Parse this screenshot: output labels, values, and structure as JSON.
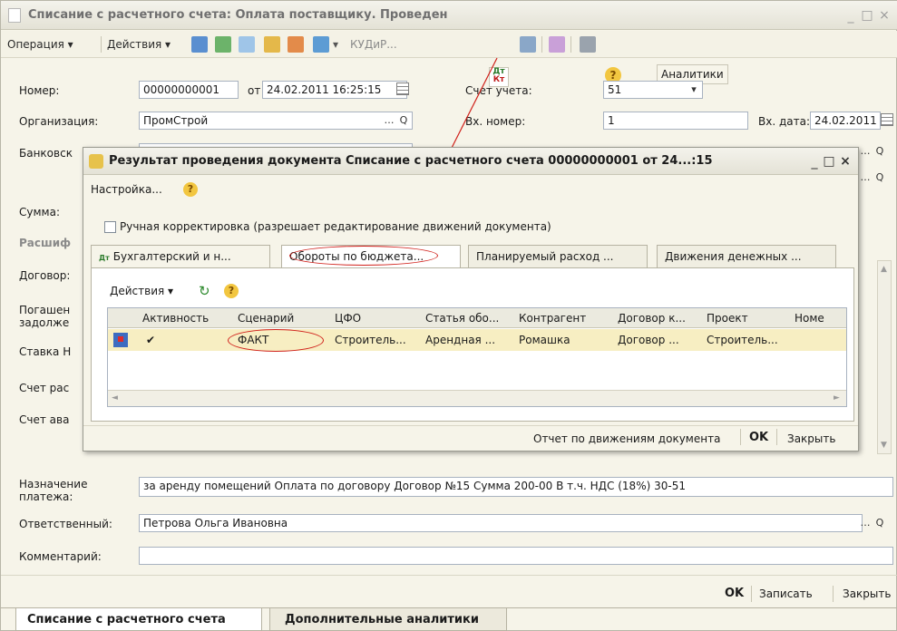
{
  "window": {
    "title": "Списание с расчетного счета: Оплата поставщику. Проведен",
    "min": "_",
    "max": "□",
    "close": "×"
  },
  "toolbar": {
    "operation": "Операция ▾",
    "actions": "Действия ▾",
    "kudir": "КУДиР...",
    "analytics": "Аналитики",
    "help": "?",
    "dtkt_top": "Дт",
    "dtkt_bottom": "Кт"
  },
  "form": {
    "number_label": "Номер:",
    "number_value": "00000000001",
    "from_label": "от",
    "date_value": "24.02.2011 16:25:15",
    "account_label": "Счет учета:",
    "account_value": "51",
    "org_label": "Организация:",
    "org_value": "ПромСтрой",
    "in_number_label": "Вх. номер:",
    "in_number_value": "1",
    "in_date_label": "Вх. дата:",
    "in_date_value": "24.02.2011",
    "bank_label": "Банковск",
    "sum_label": "Сумма:",
    "decode_label": "Расшиф",
    "contract_label": "Договор:",
    "repay_label_1": "Погашен",
    "repay_label_2": "задолже",
    "rate_label": "Ставка Н",
    "acc_calc_label": "Счет рас",
    "acc_adv_label": "Счет ава",
    "purpose_label_1": "Назначение",
    "purpose_label_2": "платежа:",
    "purpose_value": "за аренду помещений Оплата по договору Договор №15 Сумма 200-00 В т.ч. НДС  (18%) 30-51",
    "resp_label": "Ответственный:",
    "resp_value": "Петрова Ольга Ивановна",
    "comment_label": "Комментарий:",
    "comment_value": ""
  },
  "footer": {
    "ok": "OK",
    "save": "Записать",
    "close": "Закрыть"
  },
  "bottom_tabs": [
    "Списание с расчетного счета",
    "Дополнительные аналитики"
  ],
  "dialog": {
    "title": "Результат проведения документа Списание с расчетного счета 00000000001 от 24...:15",
    "settings": "Настройка...",
    "manual_label": "Ручная корректировка (разрешает редактирование движений документа)",
    "tabs": [
      "Бухгалтерский и н...",
      "Обороты по бюджета...",
      "Планируемый расход ...",
      "Движения денежных ..."
    ],
    "grid_actions": "Действия ▾",
    "columns": [
      "Активность",
      "Сценарий",
      "ЦФО",
      "Статья обо...",
      "Контрагент",
      "Договор к...",
      "Проект",
      "Номе"
    ],
    "row": [
      "✔",
      "ФАКТ",
      "Строитель...",
      "Арендная ...",
      "Ромашка",
      "Договор ...",
      "Строитель..."
    ],
    "report": "Отчет по движениям документа",
    "ok": "OK",
    "close": "Закрыть"
  },
  "colors": {
    "accent_red": "#d0201a",
    "selection": "#f7eec2",
    "title_grad": "#e4e2d6"
  }
}
